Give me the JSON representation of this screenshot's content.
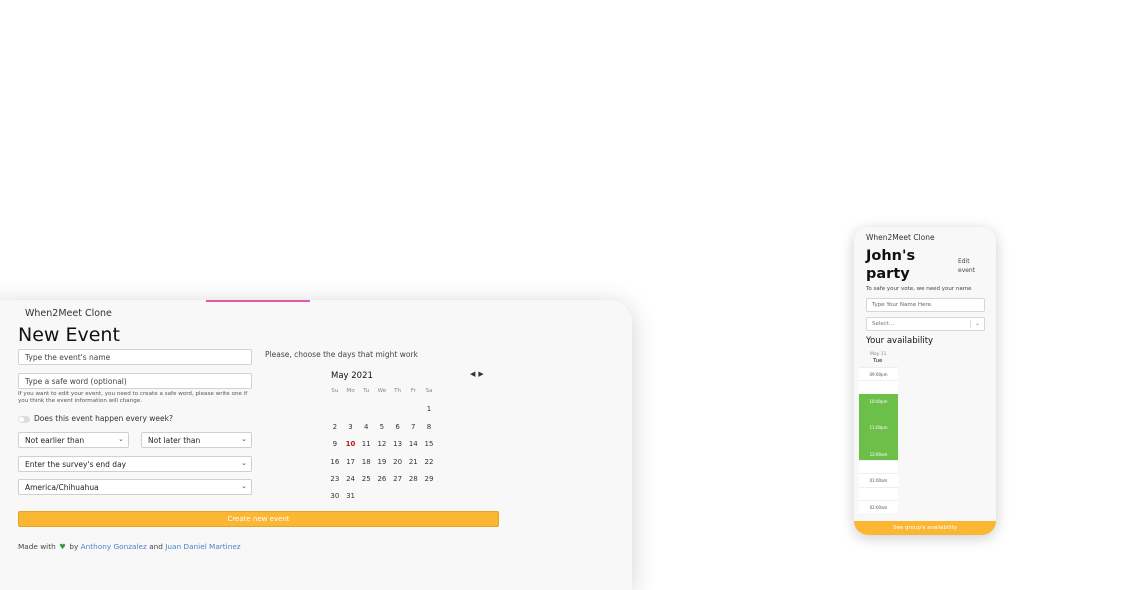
{
  "desktop": {
    "brand": "When2Meet Clone",
    "title": "New Event",
    "name_placeholder": "Type the event's name",
    "safe_word_placeholder": "Type a safe word (optional)",
    "safe_word_hint": "If you want to edit your event, you need to create a safe word, please write one if you think the event information will change.",
    "weekly_toggle_label": "Does this event happen every week?",
    "not_earlier": "Not earlier than",
    "not_later": "Not later than",
    "end_date": "Enter the survey's end day",
    "timezone": "America/Chihuahua",
    "choose_days": "Please, choose the days that might work",
    "calendar": {
      "month": "May 2021",
      "nav_prev": "◀",
      "nav_next": "▶",
      "dow": [
        "Su",
        "Mo",
        "Tu",
        "We",
        "Th",
        "Fr",
        "Sa"
      ],
      "today": "10",
      "days": [
        "",
        "",
        "",
        "",
        "",
        "",
        "1",
        "2",
        "3",
        "4",
        "5",
        "6",
        "7",
        "8",
        "9",
        "10",
        "11",
        "12",
        "13",
        "14",
        "15",
        "16",
        "17",
        "18",
        "19",
        "20",
        "21",
        "22",
        "23",
        "24",
        "25",
        "26",
        "27",
        "28",
        "29",
        "30",
        "31"
      ]
    },
    "create_button": "Create new event",
    "footer": {
      "made_with": "Made with",
      "by": "by",
      "author1": "Anthony Gonzalez",
      "and": "and",
      "author2": "Juan Daniel Martinez"
    },
    "colors": {
      "accent": "#fbb734",
      "today": "#c4161c",
      "link": "#4a7fc8",
      "heart": "#2ea043"
    }
  },
  "mobile": {
    "brand": "When2Meet Clone",
    "title": "John's party",
    "edit": "Edit event",
    "note": "To safe your vote, we need your name",
    "name_placeholder": "Type Your Name Here.",
    "select_placeholder": "Select...",
    "availability": "Your availability",
    "date": "May 11",
    "day": "Tue",
    "slots": [
      {
        "label": "09:00pm",
        "green": false
      },
      {
        "label": "",
        "green": false
      },
      {
        "label": "10:00pm",
        "green": true
      },
      {
        "label": "",
        "green": true
      },
      {
        "label": "11:00pm",
        "green": true
      },
      {
        "label": "",
        "green": true
      },
      {
        "label": "12:00am",
        "green": true
      },
      {
        "label": "",
        "green": false
      },
      {
        "label": "01:00am",
        "green": false
      },
      {
        "label": "",
        "green": false
      },
      {
        "label": "02:00am",
        "green": false
      }
    ],
    "group_button": "See group's availability",
    "colors": {
      "available": "#6cc04a",
      "accent": "#fbb734"
    }
  }
}
